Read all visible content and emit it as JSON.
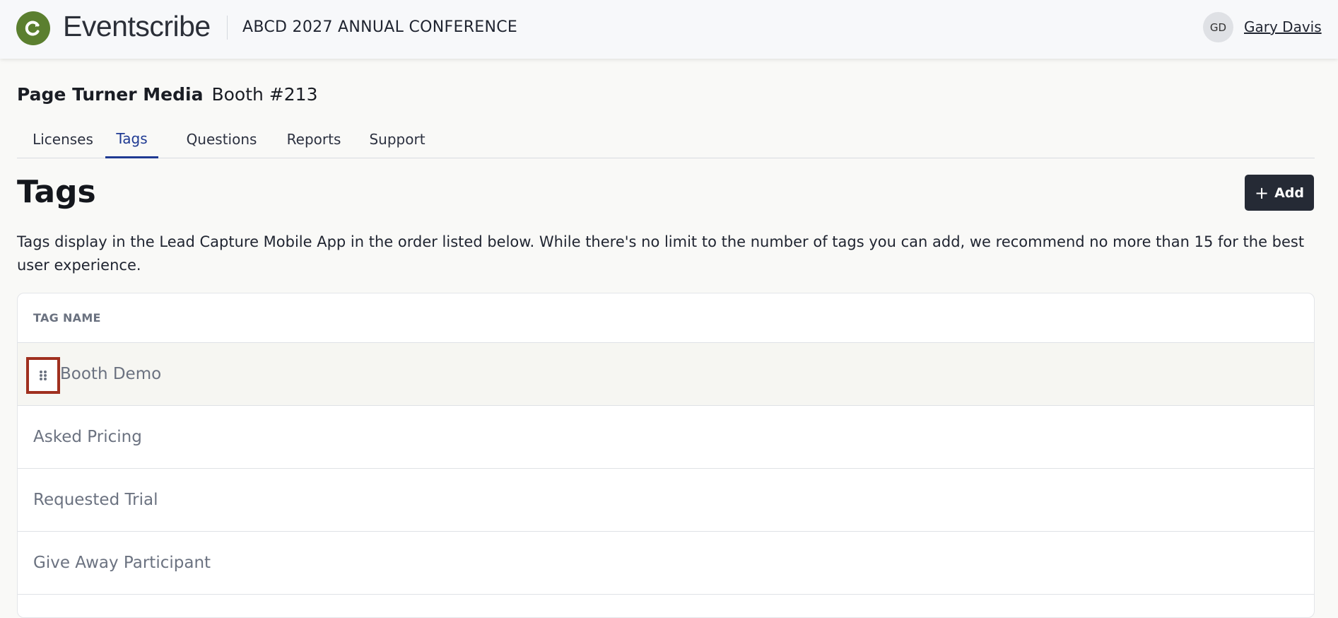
{
  "header": {
    "app_name": "Eventscribe",
    "logo_icon": "eventscribe-logo-icon",
    "event_name": "ABCD 2027 ANNUAL CONFERENCE",
    "user_initials": "GD",
    "user_name": "Gary Davis"
  },
  "company": {
    "name": "Page Turner Media",
    "booth": "Booth #213"
  },
  "tabs": [
    {
      "label": "Licenses",
      "active": false
    },
    {
      "label": "Tags",
      "active": true
    },
    {
      "label": "Questions",
      "active": false
    },
    {
      "label": "Reports",
      "active": false
    },
    {
      "label": "Support",
      "active": false
    }
  ],
  "section": {
    "title": "Tags",
    "add_label": "Add",
    "description": "Tags display in the Lead Capture Mobile App in the order listed below. While there's no limit to the number of tags you can add, we recommend no more than 15 for the best user experience."
  },
  "table": {
    "header": "TAG NAME",
    "rows": [
      {
        "name": "Booth Demo"
      },
      {
        "name": "Asked Pricing"
      },
      {
        "name": "Requested Trial"
      },
      {
        "name": "Give Away Participant"
      }
    ]
  },
  "colors": {
    "brand_green": "#5b7f2f",
    "active_tab": "#1f3a93",
    "button_dark": "#252a35",
    "drag_highlight": "#a0301f"
  }
}
